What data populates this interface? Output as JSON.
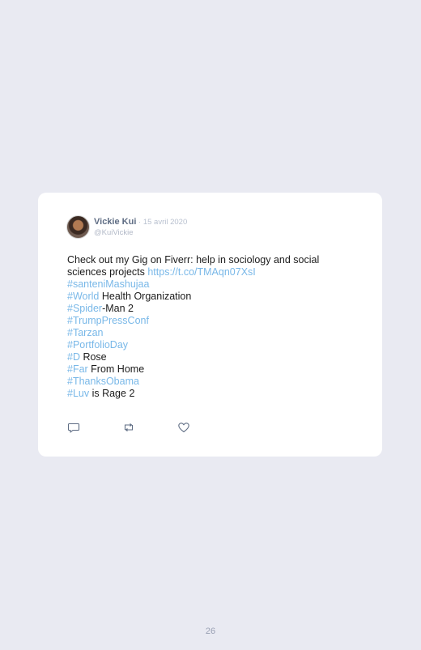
{
  "tweet": {
    "author_name": "Vickie Kui",
    "separator": " · ",
    "date": "15 avril 2020",
    "handle": "@KuiVickie",
    "text_intro": "Check out my Gig on Fiverr: help in sociology and social sciences projects ",
    "text_url": "https://t.co/TMAqn07XsI",
    "lines": [
      {
        "hashtag": "#santeniMashujaa",
        "rest": ""
      },
      {
        "hashtag": "#World",
        "rest": " Health Organization"
      },
      {
        "hashtag": "#Spider",
        "rest": "-Man 2"
      },
      {
        "hashtag": "#TrumpPressConf",
        "rest": ""
      },
      {
        "hashtag": "#Tarzan",
        "rest": ""
      },
      {
        "hashtag": "#PortfolioDay",
        "rest": ""
      },
      {
        "hashtag": "#D",
        "rest": " Rose"
      },
      {
        "hashtag": "#Far",
        "rest": " From Home"
      },
      {
        "hashtag": "#ThanksObama",
        "rest": ""
      },
      {
        "hashtag": "#Luv",
        "rest": " is Rage 2"
      }
    ],
    "actions": {
      "reply_icon": "reply-icon",
      "retweet_icon": "retweet-icon",
      "like_icon": "heart-icon"
    }
  },
  "page": {
    "number": "26"
  },
  "colors": {
    "background": "#e9eaf2",
    "card": "#ffffff",
    "link": "#79b8e8",
    "name": "#5f6d84",
    "muted": "#b8c0cf"
  }
}
